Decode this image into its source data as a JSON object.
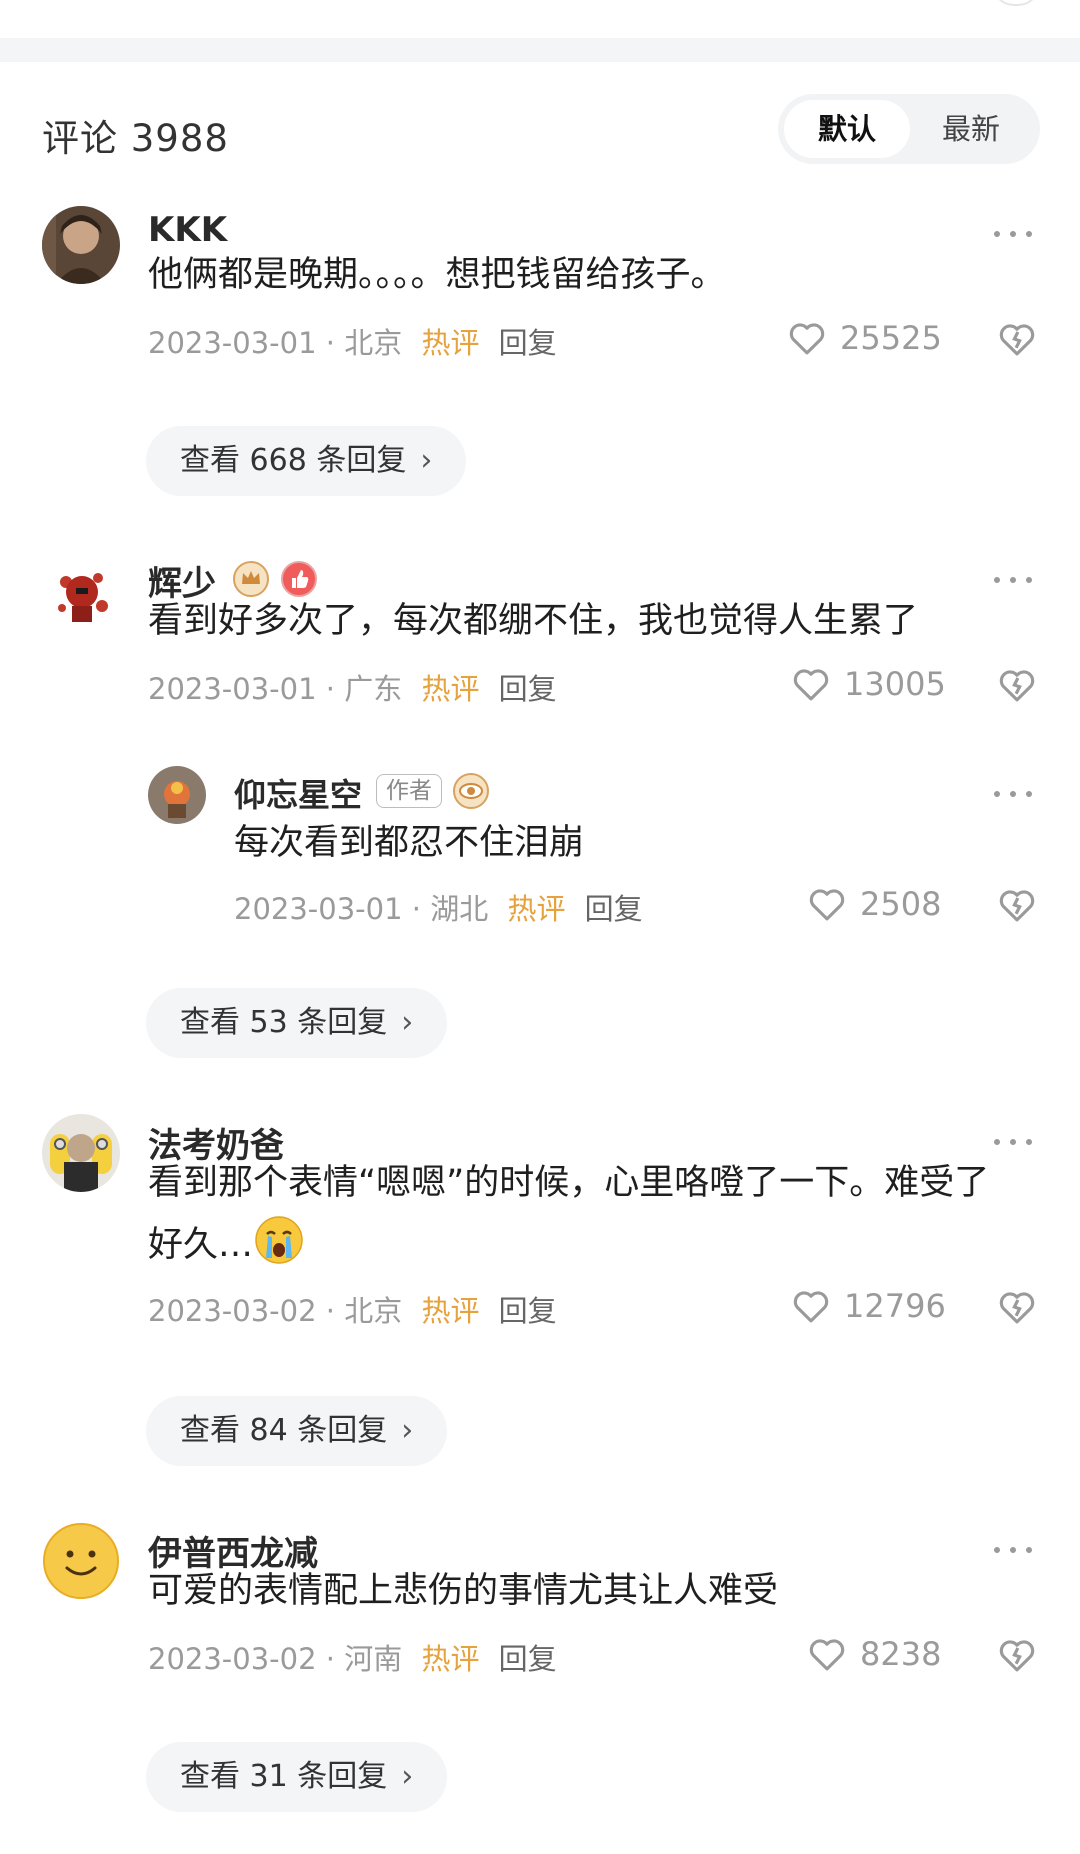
{
  "header": {
    "comment_count": "评论 3988",
    "sort_default": "默认",
    "sort_latest": "最新"
  },
  "comments": [
    {
      "username": "KKK",
      "text": "他俩都是晚期。。。。想把钱留给孩子。",
      "date": "2023-03-01",
      "location": "北京",
      "hot": "热评",
      "reply": "回复",
      "likes": "25525",
      "view_replies": "查看 668 条回复"
    },
    {
      "username": "辉少",
      "text": "看到好多次了，每次都绷不住，我也觉得人生累了",
      "date": "2023-03-01",
      "location": "广东",
      "hot": "热评",
      "reply": "回复",
      "likes": "13005",
      "sub_reply": {
        "username": "仰忘星空",
        "author_tag": "作者",
        "text": "每次看到都忍不住泪崩",
        "date": "2023-03-01",
        "location": "湖北",
        "hot": "热评",
        "reply": "回复",
        "likes": "2508"
      },
      "view_replies": "查看 53 条回复"
    },
    {
      "username": "法考奶爸",
      "text_line1": "看到那个表情“嗯嗯”的时候，心里咯噔了一下。难受了",
      "text_line2": "好久…",
      "date": "2023-03-02",
      "location": "北京",
      "hot": "热评",
      "reply": "回复",
      "likes": "12796",
      "view_replies": "查看 84 条回复"
    },
    {
      "username": "伊普西龙减",
      "text": "可爱的表情配上悲伤的事情尤其让人难受",
      "date": "2023-03-02",
      "location": "河南",
      "hot": "热评",
      "reply": "回复",
      "likes": "8238",
      "view_replies": "查看 31 条回复"
    }
  ],
  "chevron": "›",
  "meta_separator": " · ",
  "colors": {
    "hot": "#e6a23c",
    "muted": "#9a9a9a",
    "chip_bg": "#f4f5f7"
  },
  "icons": [
    "more-icon",
    "heart-icon",
    "broken-heart-icon",
    "crown-badge-icon",
    "thumb-badge-icon",
    "eye-badge-icon",
    "crying-emoji-icon"
  ]
}
